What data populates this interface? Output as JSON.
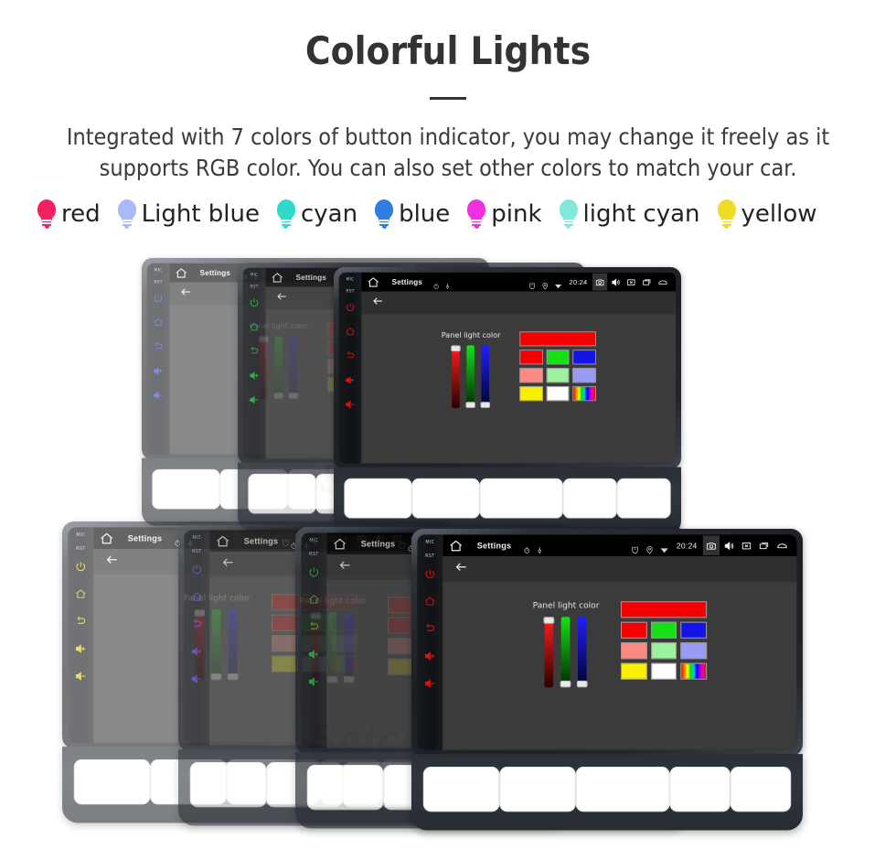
{
  "header": {
    "title": "Colorful Lights",
    "description": "Integrated with 7 colors of button indicator, you may change it freely as it supports RGB color. You can also set other colors to match your car."
  },
  "legend": {
    "items": [
      {
        "label": "red",
        "color": "#f5205f",
        "icon": "bulb-icon"
      },
      {
        "label": "Light blue",
        "color": "#a8b9f5",
        "icon": "bulb-icon"
      },
      {
        "label": "cyan",
        "color": "#2fd9cb",
        "icon": "bulb-icon"
      },
      {
        "label": "blue",
        "color": "#2f7de0",
        "icon": "bulb-icon"
      },
      {
        "label": "pink",
        "color": "#f02fe0",
        "icon": "bulb-icon"
      },
      {
        "label": "light cyan",
        "color": "#7fead9",
        "icon": "bulb-icon"
      },
      {
        "label": "yellow",
        "color": "#f0dc26",
        "icon": "bulb-icon"
      }
    ]
  },
  "watermark": {
    "text": "Seicane"
  },
  "screen": {
    "statusbar": {
      "home_icon": "home-icon",
      "title": "Settings",
      "mini_icons": [
        "stopwatch-icon",
        "pin-icon"
      ],
      "right_icons": [
        "alarm-icon",
        "location-icon",
        "wifi-icon"
      ],
      "clock": "20:24",
      "buttons": [
        {
          "name": "camera-icon",
          "active": true
        },
        {
          "name": "volume-icon",
          "active": false
        },
        {
          "name": "close-box-icon",
          "active": false
        },
        {
          "name": "recents-icon",
          "active": false
        },
        {
          "name": "back-icon",
          "active": false
        }
      ]
    },
    "actionbar": {
      "back_icon": "back-arrow-icon"
    },
    "panel": {
      "label": "Panel light color",
      "sliders": [
        {
          "name": "red-slider",
          "channel": "R",
          "value": 100,
          "thumb_position": "top"
        },
        {
          "name": "green-slider",
          "channel": "G",
          "value": 0,
          "thumb_position": "bottom"
        },
        {
          "name": "blue-slider",
          "channel": "B",
          "value": 0,
          "thumb_position": "bottom"
        }
      ],
      "preview_color": "#f50000",
      "swatch_rows": [
        [
          {
            "color": "#f50000",
            "name": "swatch-red"
          },
          {
            "color": "#14e114",
            "name": "swatch-green"
          },
          {
            "color": "#1414e6",
            "name": "swatch-blue"
          }
        ],
        [
          {
            "color": "#fb8a84",
            "name": "swatch-salmon"
          },
          {
            "color": "#9ef29e",
            "name": "swatch-mint"
          },
          {
            "color": "#9a9af5",
            "name": "swatch-periwinkle"
          }
        ],
        [
          {
            "color": "#fbf000",
            "name": "swatch-yellow"
          },
          {
            "color": "#ffffff",
            "name": "swatch-white"
          },
          {
            "color": "rainbow",
            "name": "swatch-rainbow"
          }
        ]
      ]
    }
  },
  "units": {
    "keystrip": {
      "labels": [
        "MIC",
        "RST"
      ],
      "icons": [
        "power-icon",
        "home-icon",
        "return-icon",
        "volume-up-icon",
        "volume-down-icon"
      ]
    },
    "top_row": [
      {
        "name": "head-unit-top-1",
        "led_color": "#2244dd"
      },
      {
        "name": "head-unit-top-2",
        "led_color": "#18b838"
      },
      {
        "name": "head-unit-top-3",
        "led_color": "#dd1111"
      }
    ],
    "bottom_row": [
      {
        "name": "head-unit-bottom-1",
        "led_color": "#d8c914"
      },
      {
        "name": "head-unit-bottom-2",
        "led_color": "#4a3fd4"
      },
      {
        "name": "head-unit-bottom-3",
        "led_color": "#18b838"
      },
      {
        "name": "head-unit-bottom-4",
        "led_color": "#dd1111"
      }
    ]
  }
}
